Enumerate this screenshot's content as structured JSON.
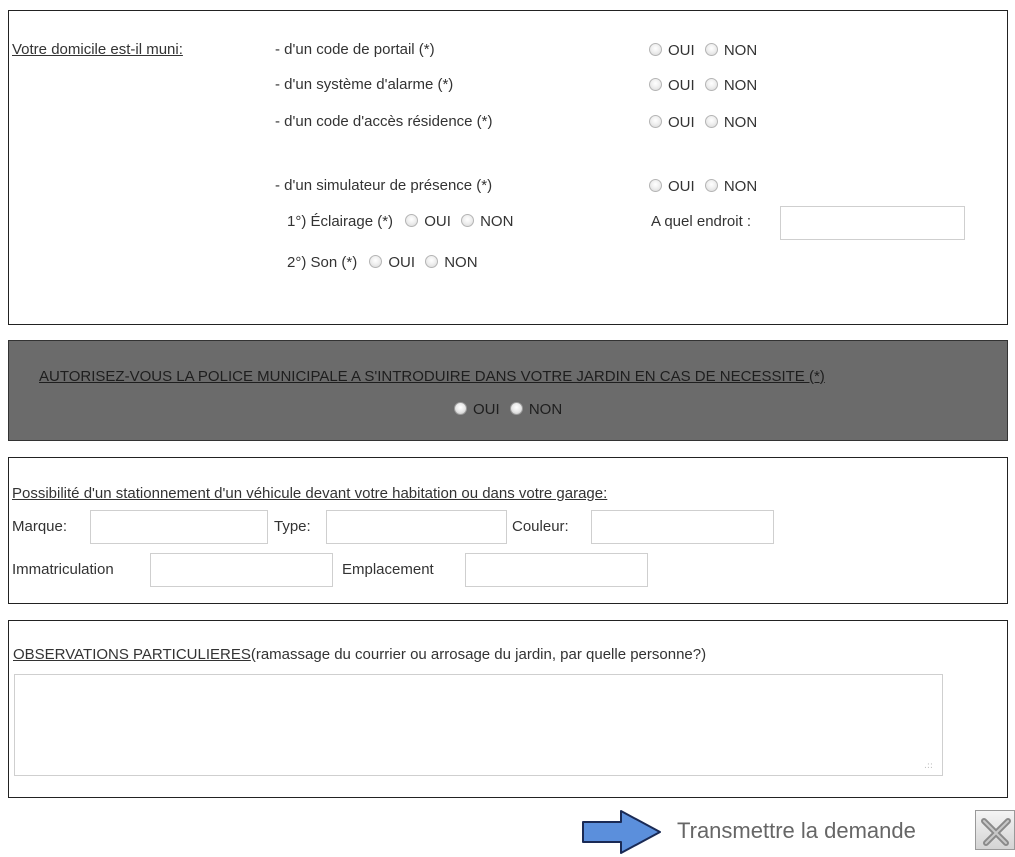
{
  "equipment": {
    "label": "Votre domicile est-il muni:",
    "items": [
      {
        "text": "- d'un code de portail (*)",
        "yes": "OUI",
        "no": "NON"
      },
      {
        "text": "- d'un système d'alarme (*)",
        "yes": "OUI",
        "no": "NON"
      },
      {
        "text": "- d'un code d'accès résidence (*)",
        "yes": "OUI",
        "no": "NON"
      },
      {
        "text": "- d'un simulateur de présence (*)",
        "yes": "OUI",
        "no": "NON"
      }
    ],
    "lighting": {
      "label": "1°) Éclairage (*)",
      "yes": "OUI",
      "no": "NON"
    },
    "sound": {
      "label": "2°) Son (*)",
      "yes": "OUI",
      "no": "NON"
    },
    "location_label": "A quel endroit :",
    "location_value": ""
  },
  "police": {
    "question": "AUTORISEZ-VOUS LA POLICE MUNICIPALE A S'INTRODUIRE DANS VOTRE JARDIN EN CAS DE NECESSITE (*)",
    "yes": "OUI",
    "no": "NON"
  },
  "vehicle": {
    "title": "Possibilité d'un stationnement d'un véhicule devant votre habitation ou dans votre garage:",
    "marque_label": "Marque:",
    "type_label": "Type:",
    "couleur_label": "Couleur:",
    "immatriculation_label": "Immatriculation",
    "emplacement_label": "Emplacement",
    "marque_value": "",
    "type_value": "",
    "couleur_value": "",
    "immatriculation_value": "",
    "emplacement_value": ""
  },
  "observations": {
    "title": "OBSERVATIONS PARTICULIERES",
    "subtitle": "(ramassage du courrier ou arrosage du jardin, par quelle personne?)",
    "value": ""
  },
  "submit": {
    "label": "Transmettre la demande"
  },
  "colors": {
    "band_background": "#6b6b6b",
    "arrow_fill": "#5b8fdc",
    "submit_text": "#666666"
  },
  "icons": {
    "arrow": "right-arrow-icon",
    "submit": "tools-icon"
  }
}
